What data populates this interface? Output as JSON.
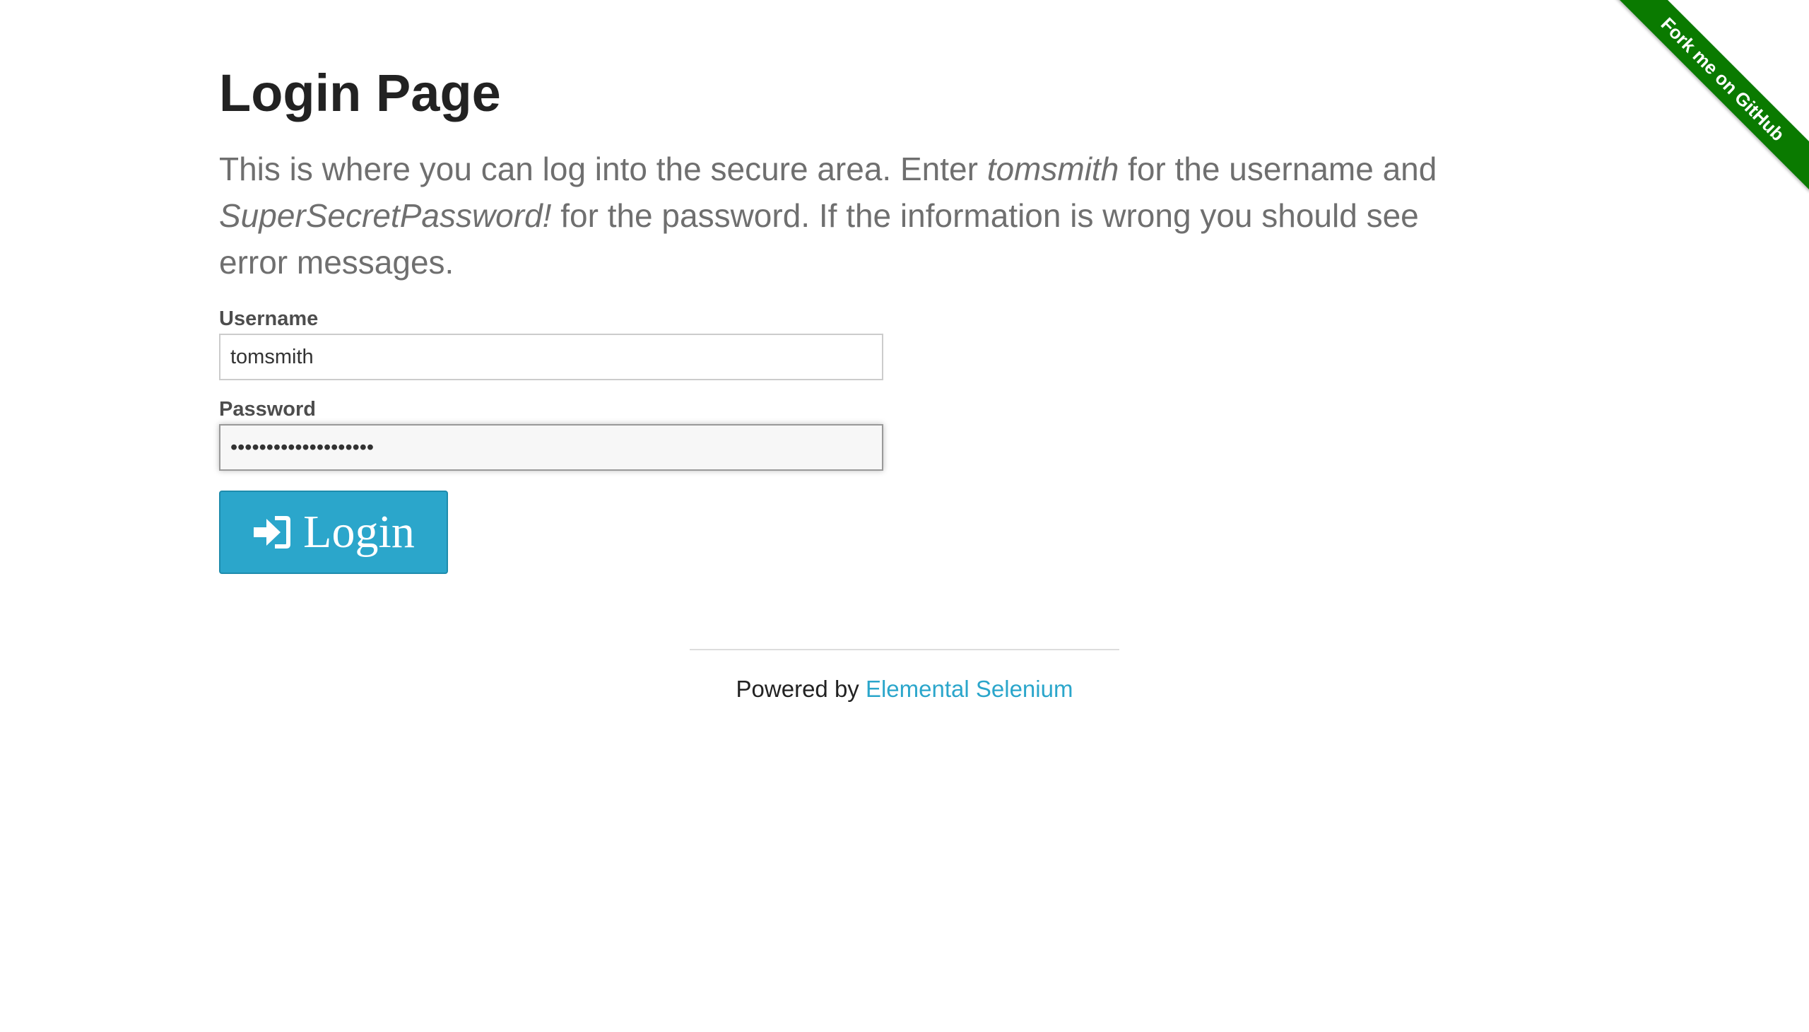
{
  "ribbon": {
    "text": "Fork me on GitHub",
    "color": "#0a7a00"
  },
  "page": {
    "title": "Login Page",
    "subheader": {
      "part1": "This is where you can log into the secure area. Enter ",
      "username_hint": "tomsmith",
      "part2": " for the username and ",
      "password_hint": "SuperSecretPassword!",
      "part3": " for the password. If the information is wrong you should see error messages."
    }
  },
  "form": {
    "username_label": "Username",
    "username_value": "tomsmith",
    "password_label": "Password",
    "password_value": "SuperSecretPassword!",
    "login_label": "Login",
    "login_icon": "sign-in-icon",
    "button_color": "#2ba6cb"
  },
  "footer": {
    "prefix": "Powered by ",
    "link_text": "Elemental Selenium",
    "link_color": "#2ba6cb"
  }
}
